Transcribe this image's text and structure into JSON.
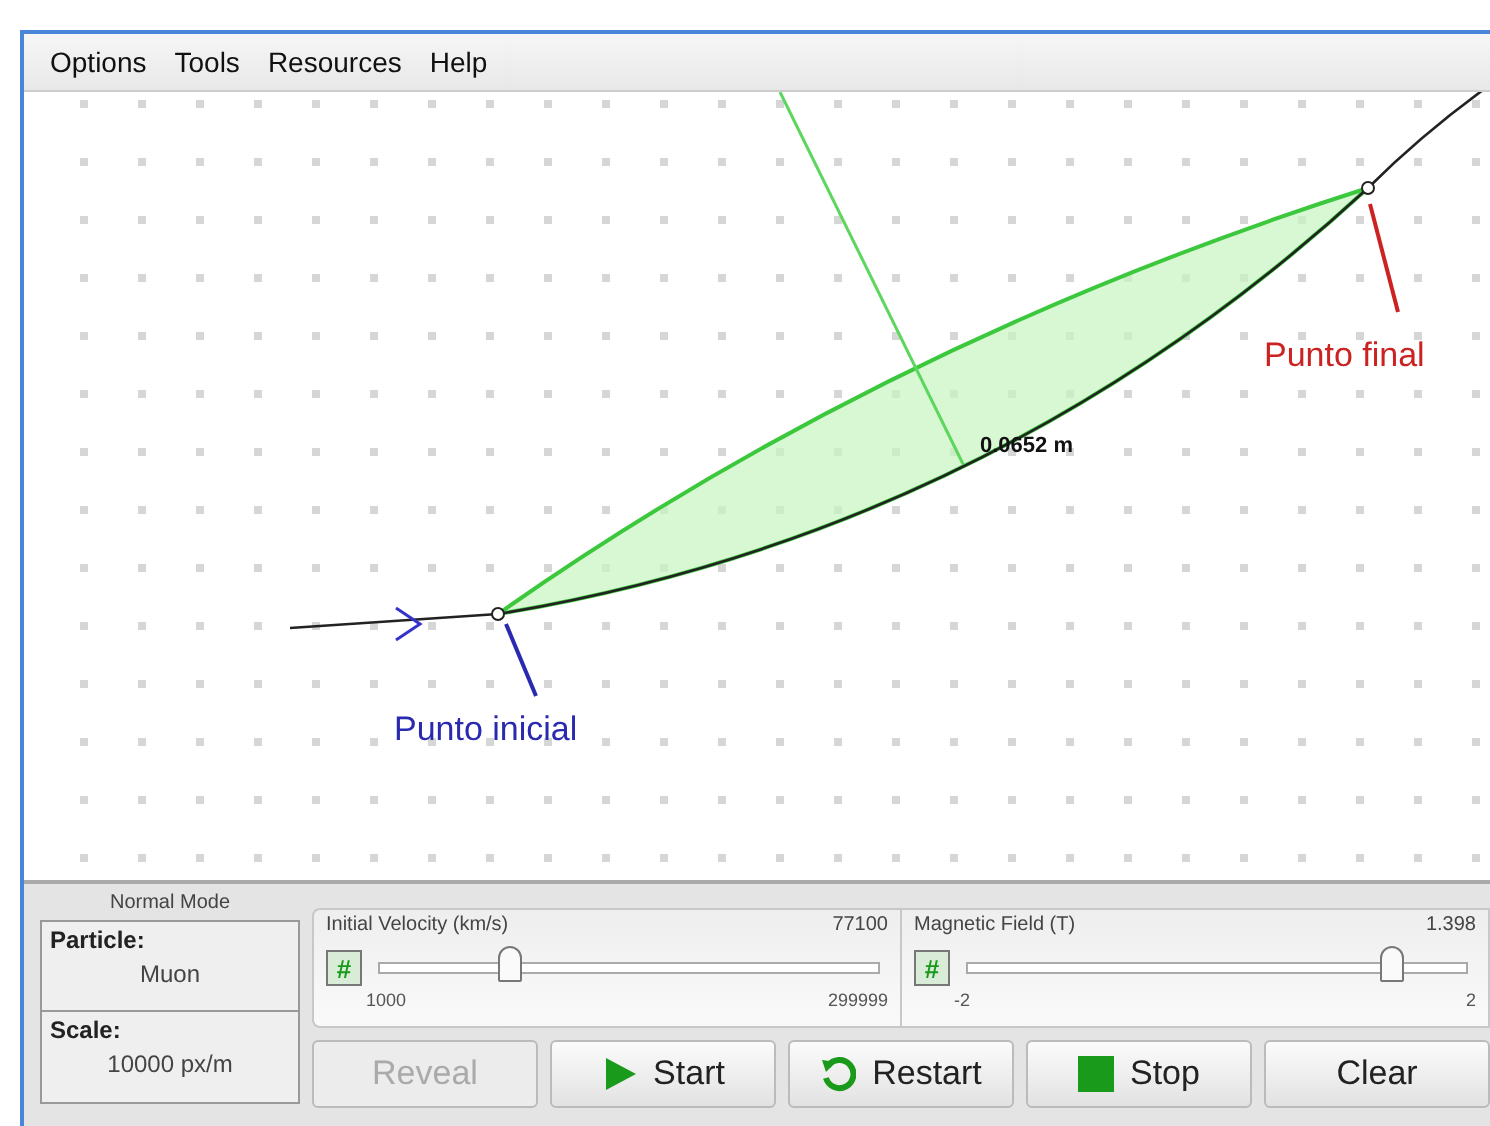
{
  "menu": [
    "Options",
    "Tools",
    "Resources",
    "Help"
  ],
  "canvas": {
    "distance_label": "0.0652 m",
    "start_label": "Punto inicial",
    "end_label": "Punto final"
  },
  "mode": "Normal Mode",
  "info": [
    {
      "label": "Particle:",
      "value": "Muon"
    },
    {
      "label": "Scale:",
      "value": "10000 px/m"
    }
  ],
  "sliders": [
    {
      "label": "Initial Velocity (km/s)",
      "entry_button": "#",
      "value": "77100",
      "min": "1000",
      "max": "299999",
      "level": 0.26
    },
    {
      "label": "Magnetic Field (T)",
      "entry_button": "#",
      "value": "1.398",
      "min": "-2",
      "max": "2",
      "level": 0.85
    }
  ],
  "buttons": [
    {
      "label": "Reveal",
      "kind": "plain",
      "disabled": true
    },
    {
      "label": "Start",
      "kind": "play",
      "disabled": false
    },
    {
      "label": "Restart",
      "kind": "restart",
      "disabled": false
    },
    {
      "label": "Stop",
      "kind": "stop",
      "disabled": false
    },
    {
      "label": "Clear",
      "kind": "plain",
      "disabled": false
    }
  ]
}
